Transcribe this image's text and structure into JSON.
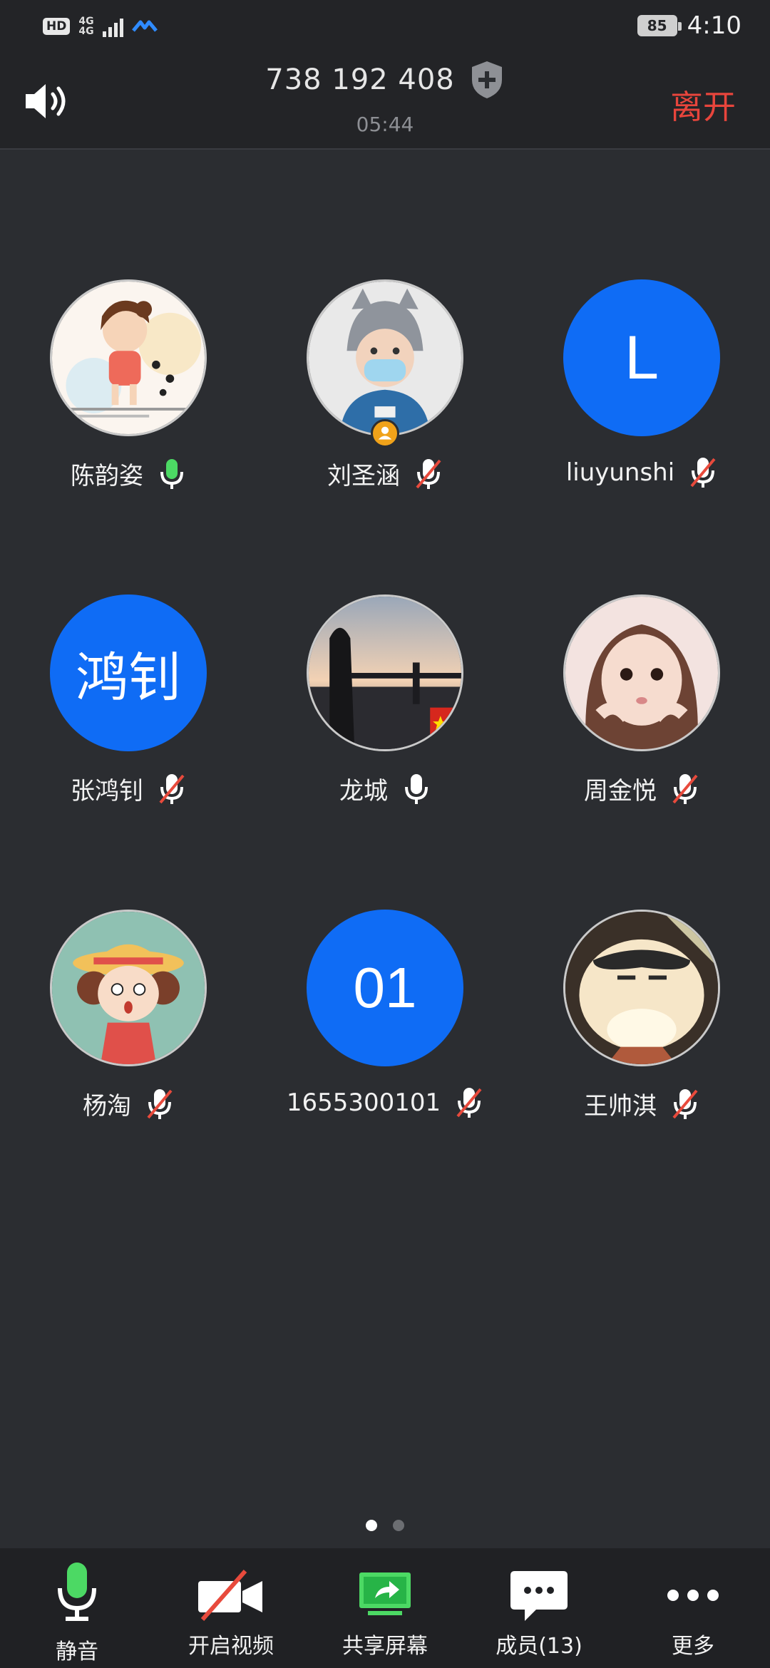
{
  "status_bar": {
    "hd": "HD",
    "network_top": "4G",
    "network_bottom": "4G",
    "battery": "85",
    "time": "4:10"
  },
  "header": {
    "meeting_id": "738 192 408",
    "duration": "05:44",
    "leave_label": "离开"
  },
  "participants": [
    {
      "name": "陈韵姿",
      "mic": "on",
      "avatar": "photo-girl-cartoon"
    },
    {
      "name": "刘圣涵",
      "mic": "muted",
      "avatar": "photo-boy-hat",
      "host": true
    },
    {
      "name": "liuyunshi",
      "mic": "muted",
      "avatar_text": "L"
    },
    {
      "name": "张鸿钊",
      "mic": "muted",
      "avatar_text": "鸿钊"
    },
    {
      "name": "龙城",
      "mic": "unmuted",
      "avatar": "photo-sunset-person"
    },
    {
      "name": "周金悦",
      "mic": "muted",
      "avatar": "photo-girl"
    },
    {
      "name": "杨淘",
      "mic": "muted",
      "avatar": "photo-cartoon-girl-hat"
    },
    {
      "name": "1655300101",
      "mic": "muted",
      "avatar_text": "01"
    },
    {
      "name": "王帅淇",
      "mic": "muted",
      "avatar": "photo-cartoon-boy"
    }
  ],
  "pager": {
    "pages": 2,
    "current": 1
  },
  "toolbar": {
    "mute": "静音",
    "video": "开启视频",
    "share": "共享屏幕",
    "members": "成员(13)",
    "more": "更多"
  },
  "colors": {
    "background": "#2b2d31",
    "accent_blue": "#0f6cf5",
    "leave_red": "#e8453c",
    "mic_green": "#4cd964",
    "muted_red": "#e84a3c"
  }
}
